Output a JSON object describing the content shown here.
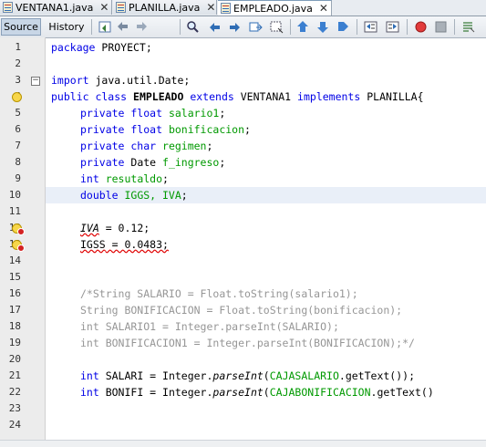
{
  "tabs": [
    {
      "label": "VENTANA1.java",
      "active": false
    },
    {
      "label": "PLANILLA.java",
      "active": false
    },
    {
      "label": "EMPLEADO.java",
      "active": true
    }
  ],
  "toolbar": {
    "source_label": "Source",
    "history_label": "History",
    "icons": [
      "last-edit-icon",
      "back-icon",
      "forward-icon",
      "find-icon",
      "find-previous-icon",
      "find-next-icon",
      "find-selection-icon",
      "toggle-highlight-icon",
      "previous-bookmark-icon",
      "next-bookmark-icon",
      "toggle-bookmark-icon",
      "shift-left-icon",
      "shift-right-icon",
      "start-macro-icon",
      "stop-macro-icon",
      "comment-icon"
    ]
  },
  "editor": {
    "line_numbers": [
      "1",
      "2",
      "3",
      "4",
      "5",
      "6",
      "7",
      "8",
      "9",
      "10",
      "11",
      "12",
      "13",
      "14",
      "15",
      "16",
      "17",
      "18",
      "19",
      "20",
      "21",
      "22",
      "23",
      "24"
    ],
    "lines": {
      "l1": {
        "kw": "package",
        "rest": " PROYECT;"
      },
      "l3": {
        "kw": "import",
        "rest": " java.util.Date;"
      },
      "l4": {
        "kw1": "public class ",
        "name": "EMPLEADO",
        "kw2": " extends",
        "mid": " VENTANA1 ",
        "kw3": "implements",
        "rest": " PLANILLA{"
      },
      "l5": {
        "kw": "private float",
        "fld": " salario1",
        "rest": ";"
      },
      "l6": {
        "kw": "private float",
        "fld": " bonificacion",
        "rest": ";"
      },
      "l7": {
        "kw": "private char",
        "fld": " regimen",
        "rest": ";"
      },
      "l8": {
        "kw": "private",
        "type": " Date",
        "fld": " f_ingreso",
        "rest": ";"
      },
      "l9": {
        "kw": "int",
        "fld": " resutaldo",
        "rest": ";"
      },
      "l10": {
        "kw": "double",
        "fld": " IGGS, IVA",
        "rest": ";"
      },
      "l12": {
        "var": "IVA",
        "rest": " = 0.12;"
      },
      "l13": {
        "var": "IGSS",
        "rest": " = 0.0483;"
      },
      "l16": "/*String SALARIO = Float.toString(salario1);",
      "l17": "String BONIFICACION = Float.toString(bonificacion);",
      "l18": "int SALARIO1 = Integer.parseInt(SALARIO);",
      "l19": "int BONIFICACION1 = Integer.parseInt(BONIFICACION);*/",
      "l21": {
        "kw": "int",
        "a": " SALARI = Integer.",
        "m": "parseInt",
        "b": "(",
        "f": "CAJASALARIO",
        "c": ".getText());"
      },
      "l22": {
        "kw": "int",
        "a": " BONIFI = Integer.",
        "m": "parseInt",
        "b": "(",
        "f": "CAJABONIFICACION",
        "c": ".getText()"
      }
    }
  },
  "colors": {
    "keyword": "#0000e6",
    "field": "#009900",
    "comment": "#969696",
    "current_line": "#e9eff8",
    "error": "#d42222"
  }
}
